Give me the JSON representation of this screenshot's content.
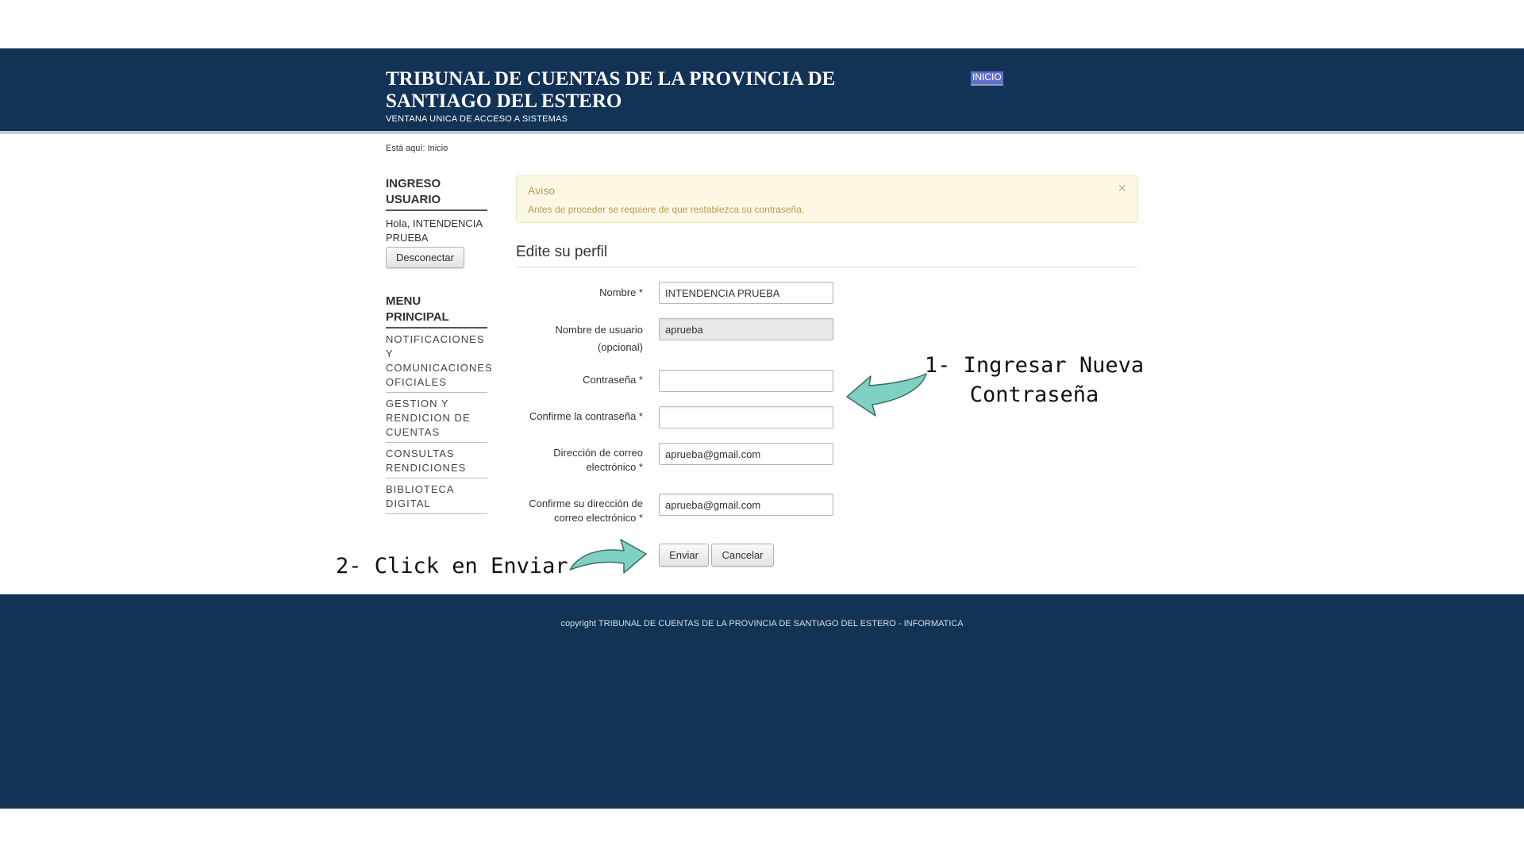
{
  "header": {
    "title": "TRIBUNAL DE CUENTAS DE LA PROVINCIA DE SANTIAGO DEL ESTERO",
    "subtitle": "VENTANA UNICA DE ACCESO A SISTEMAS",
    "nav_inicio": "INICIO"
  },
  "breadcrumb": "Está aquí: Inicio",
  "sidebar": {
    "login_heading": "INGRESO USUARIO",
    "greeting": "Hola, INTENDENCIA PRUEBA",
    "logout_label": "Desconectar",
    "menu_heading": "MENU PRINCIPAL",
    "menu_items": [
      {
        "label": "NOTIFICACIONES Y COMUNICACIONES OFICIALES"
      },
      {
        "label": "GESTION Y RENDICION DE CUENTAS"
      },
      {
        "label": "CONSULTAS RENDICIONES"
      },
      {
        "label": "BIBLIOTECA DIGITAL"
      }
    ]
  },
  "notice": {
    "title": "Aviso",
    "message": "Antes de proceder se requiere de que restablezca su contraseña.",
    "close": "×"
  },
  "form": {
    "title": "Edite su perfil",
    "name_label": "Nombre *",
    "name_value": "INTENDENCIA PRUEBA",
    "username_label": "Nombre de usuario (opcional)",
    "username_value": "aprueba",
    "password_label": "Contraseña *",
    "password_value": "",
    "confirm_password_label": "Confirme la contraseña *",
    "confirm_password_value": "",
    "email_label": "Dirección de correo electrónico *",
    "email_value": "aprueba@gmail.com",
    "confirm_email_label": "Confirme su dirección de correo electrónico *",
    "confirm_email_value": "aprueba@gmail.com",
    "submit_label": "Enviar",
    "cancel_label": "Cancelar"
  },
  "annotations": {
    "step1": "1- Ingresar Nueva Contraseña",
    "step2": "2- Click en Enviar"
  },
  "footer": {
    "copyright": "copyright TRIBUNAL DE CUENTAS DE LA PROVINCIA DE SANTIAGO DEL ESTERO - INFORMATICA"
  },
  "colors": {
    "header_bg": "#123256",
    "notice_bg": "#fcf8e3",
    "notice_text": "#c09853",
    "arrow_fill": "#7fd1c4"
  },
  "icons": {
    "arrow_step1": "arrow-left-icon",
    "arrow_step2": "arrow-right-icon",
    "notice_close": "close-icon"
  }
}
